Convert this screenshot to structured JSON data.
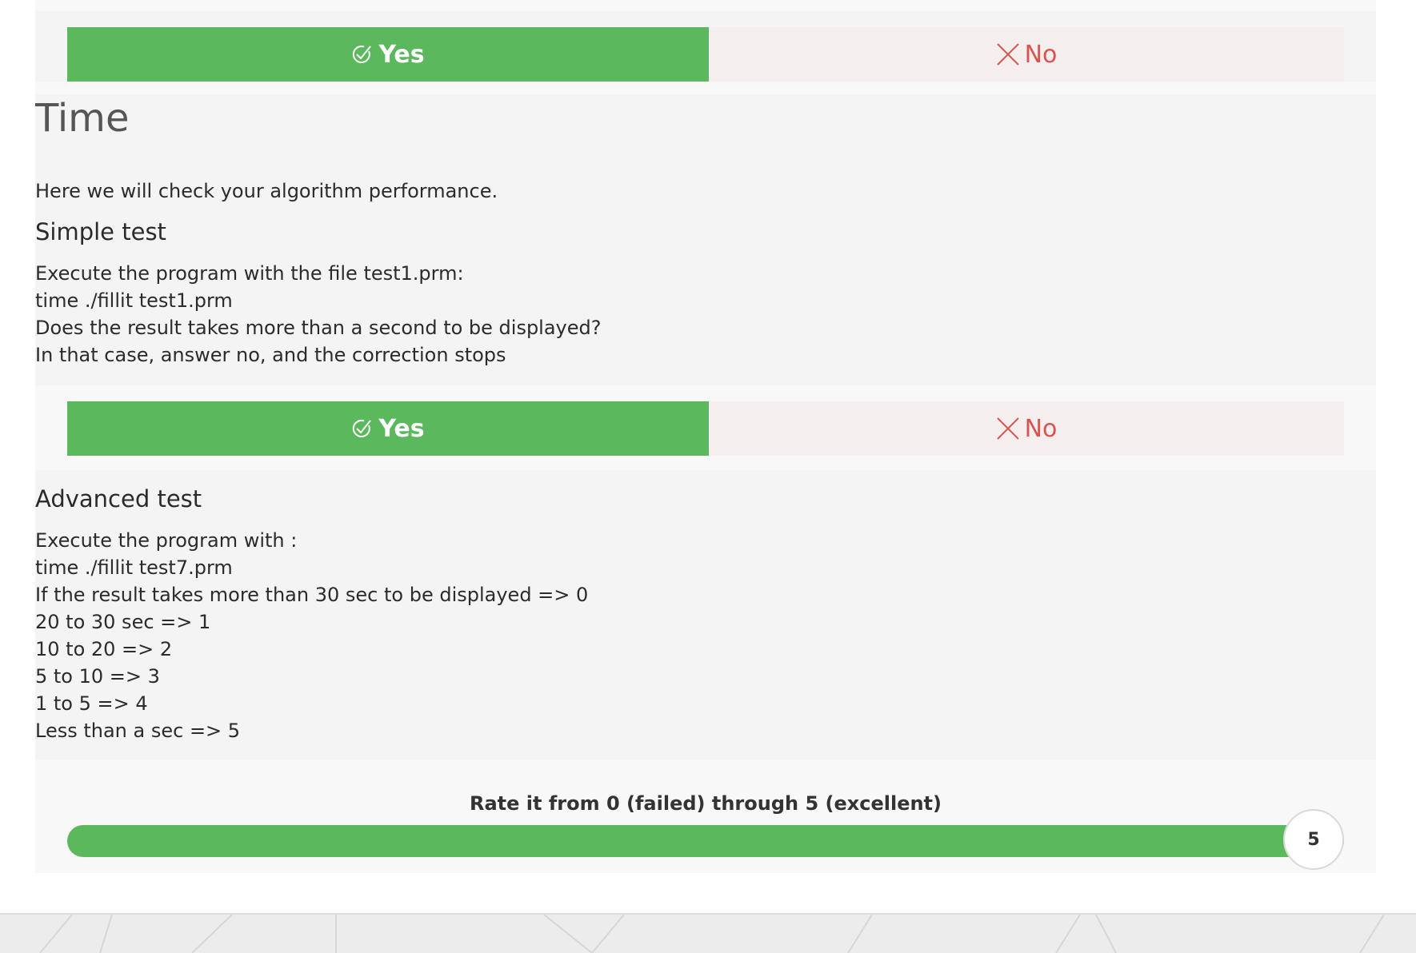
{
  "section": {
    "title": "Time",
    "intro": "Here we will check your algorithm performance."
  },
  "top_question": {
    "yes_label": "Yes",
    "no_label": "No",
    "selected": "yes"
  },
  "simple_test": {
    "heading": "Simple test",
    "lines": [
      "Execute the program with the file test1.prm:",
      "time ./fillit test1.prm",
      "Does the result takes more than a second to be displayed?",
      "In that case, answer no, and the correction stops"
    ],
    "yes_label": "Yes",
    "no_label": "No",
    "selected": "yes"
  },
  "advanced_test": {
    "heading": "Advanced test",
    "lines": [
      "Execute the program with :",
      "time ./fillit test7.prm",
      "If the result takes more than 30 sec to be displayed => 0",
      "20 to 30 sec => 1",
      "10 to 20 => 2",
      "5 to 10 => 3",
      "1 to 5 => 4",
      "Less than a sec => 5"
    ]
  },
  "rating": {
    "label": "Rate it from 0 (failed) through 5 (excellent)",
    "value": "5",
    "min": 0,
    "max": 5,
    "fraction": 1.0
  },
  "colors": {
    "yes_green": "#5cb85c",
    "no_red": "#d9534f",
    "card_bg": "#f4f4f4"
  },
  "icons": {
    "yes": "check-circle-icon",
    "no": "x-icon"
  }
}
